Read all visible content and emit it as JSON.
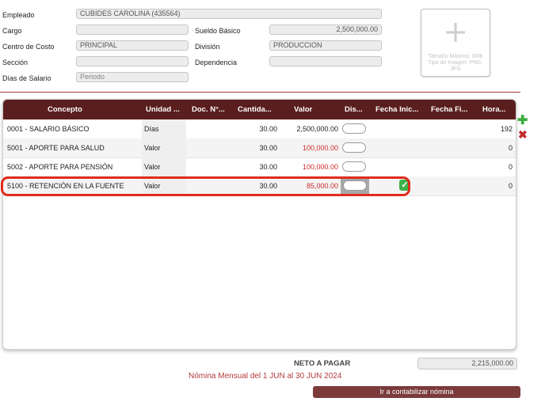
{
  "form": {
    "empleado_label": "Empleado",
    "empleado_value": "CUBIDES  CAROLINA (435564)",
    "cargo_label": "Cargo",
    "cargo_value": "",
    "sueldo_label": "Sueldo Básico",
    "sueldo_value": "2,500,000.00",
    "centro_label": "Centro de Costo",
    "centro_value": "PRINCIPAL",
    "division_label": "División",
    "division_value": "PRODUCCION",
    "seccion_label": "Sección",
    "seccion_value": "",
    "dependencia_label": "Dependencia",
    "dependencia_value": "",
    "dias_label": "Días de Salario",
    "dias_placeholder": "Periodo"
  },
  "photo": {
    "icon": "plus-icon",
    "note": "Tamaño Máximo: 3Mb Tipo de Imagen: PNG, JPG"
  },
  "table": {
    "headers": [
      "Concepto",
      "Unidad ...",
      "Doc. N°...",
      "Cantida...",
      "Valor",
      "Dis...",
      "Fecha Inic...",
      "Fecha Fi...",
      "Hora..."
    ],
    "rows": [
      {
        "concepto": "0001 - SALARIO BÁSICO",
        "unidad": "Días",
        "doc": "",
        "cantidad": "30.00",
        "valor": "2,500,000.00",
        "fecha_ini": "",
        "fecha_fin": "",
        "horas": "192"
      },
      {
        "concepto": "5001 - APORTE PARA SALUD",
        "unidad": "Valor",
        "doc": "",
        "cantidad": "30.00",
        "valor": "100,000.00",
        "fecha_ini": "",
        "fecha_fin": "",
        "horas": "0"
      },
      {
        "concepto": "5002 - APORTE PARA PENSIÓN",
        "unidad": "Valor",
        "doc": "",
        "cantidad": "30.00",
        "valor": "100,000.00",
        "fecha_ini": "",
        "fecha_fin": "",
        "horas": "0"
      },
      {
        "concepto": "5100 - RETENCIÓN EN LA FUENTE",
        "unidad": "Valor",
        "doc": "",
        "cantidad": "30.00",
        "valor": "85,000.00",
        "fecha_ini": "",
        "fecha_fin": "",
        "horas": "0"
      }
    ]
  },
  "side_actions": {
    "add_icon": "plus-icon",
    "delete_icon": "x-icon"
  },
  "footer": {
    "neto_label": "NETO A PAGAR",
    "neto_value": "2,215,000.00",
    "period_text": "Nómina Mensual del 1 JUN al 30 JUN 2024",
    "button_label": "Ir a contabilizar nómina"
  },
  "colors": {
    "header_bg": "#5a1e1e",
    "accent": "#7b3b3b",
    "red_value": "#cc2a2a",
    "highlight": "#e02b1e",
    "check": "#3db24a"
  }
}
